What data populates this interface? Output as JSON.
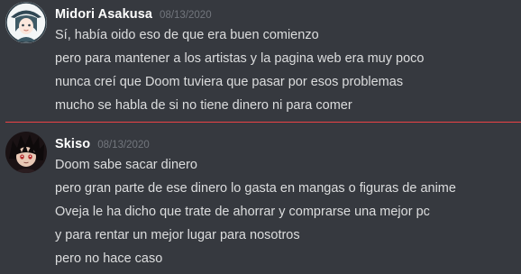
{
  "messages": [
    {
      "username": "Midori Asakusa",
      "timestamp": "08/13/2020",
      "avatar_icon": "midori-avatar",
      "lines": [
        "Sí, había oido eso de que era buen comienzo",
        "pero para mantener a los artistas y la pagina web era muy poco",
        "nunca creí que Doom tuviera que pasar por esos problemas",
        "mucho se habla de si no tiene dinero ni para comer"
      ]
    },
    {
      "username": "Skiso",
      "timestamp": "08/13/2020",
      "avatar_icon": "skiso-avatar",
      "lines": [
        "Doom sabe sacar dinero",
        "pero gran parte de ese dinero lo gasta en mangas o figuras de anime",
        "Oveja le ha dicho que trate de ahorrar y comprarse una mejor pc",
        "y para rentar un mejor lugar para nosotros",
        "pero no hace caso"
      ]
    }
  ],
  "colors": {
    "background": "#36393f",
    "username": "#ffffff",
    "timestamp": "#72767d",
    "text": "#dcddde",
    "new_messages_divider": "#ed4245"
  }
}
